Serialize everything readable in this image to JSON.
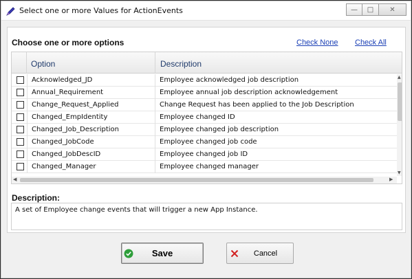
{
  "window": {
    "title": "Select one or more Values for ActionEvents",
    "minimize_glyph": "—",
    "maximize_glyph": "□",
    "close_glyph": "✕"
  },
  "panel": {
    "heading": "Choose one or more options",
    "check_none": "Check None",
    "check_all": "Check All"
  },
  "grid": {
    "columns": [
      "Option",
      "Description"
    ],
    "rows": [
      {
        "option": "Acknowledged_JD",
        "description": "Employee acknowledged job description",
        "checked": false
      },
      {
        "option": "Annual_Requirement",
        "description": "Employee annual job description acknowledgement",
        "checked": false
      },
      {
        "option": "Change_Request_Applied",
        "description": "Change Request has been applied to the Job Description",
        "checked": false
      },
      {
        "option": "Changed_EmpIdentity",
        "description": "Employee changed ID",
        "checked": false
      },
      {
        "option": "Changed_Job_Description",
        "description": "Employee changed job description",
        "checked": false
      },
      {
        "option": "Changed_JobCode",
        "description": "Employee changed job code",
        "checked": false
      },
      {
        "option": "Changed_JobDescID",
        "description": "Employee changed job ID",
        "checked": false
      },
      {
        "option": "Changed_Manager",
        "description": "Employee changed manager",
        "checked": false
      }
    ]
  },
  "description": {
    "label": "Description:",
    "text": "A set of Employee change events that will trigger a new App Instance."
  },
  "buttons": {
    "save": "Save",
    "cancel": "Cancel"
  },
  "icons": {
    "title": "pen-icon",
    "save": "check-circle-icon",
    "cancel": "x-icon"
  },
  "colors": {
    "link": "#1a3fb5",
    "header_text": "#1f3a6b",
    "save_icon": "#2e9e3a",
    "cancel_icon": "#d22222"
  }
}
